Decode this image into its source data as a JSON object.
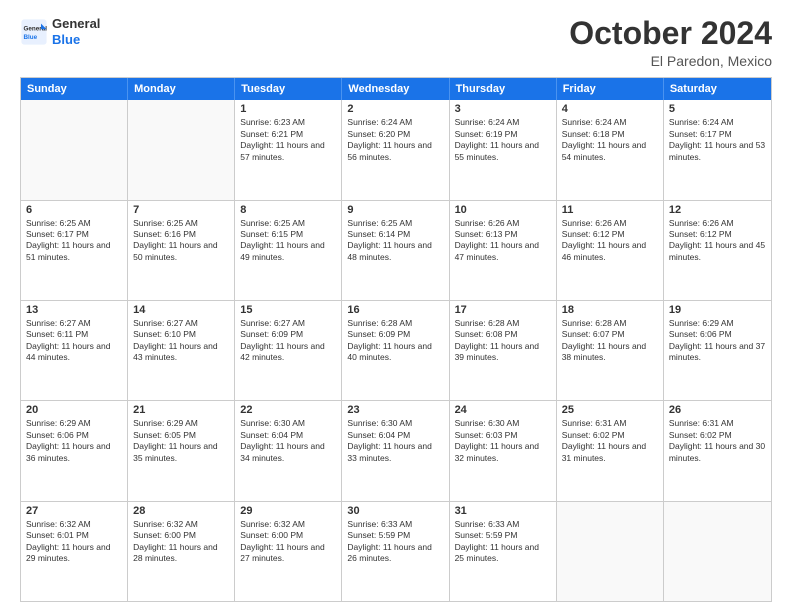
{
  "logo": {
    "line1": "General",
    "line2": "Blue"
  },
  "header": {
    "month": "October 2024",
    "location": "El Paredon, Mexico"
  },
  "weekdays": [
    "Sunday",
    "Monday",
    "Tuesday",
    "Wednesday",
    "Thursday",
    "Friday",
    "Saturday"
  ],
  "rows": [
    [
      {
        "day": "",
        "info": ""
      },
      {
        "day": "",
        "info": ""
      },
      {
        "day": "1",
        "info": "Sunrise: 6:23 AM\nSunset: 6:21 PM\nDaylight: 11 hours and 57 minutes."
      },
      {
        "day": "2",
        "info": "Sunrise: 6:24 AM\nSunset: 6:20 PM\nDaylight: 11 hours and 56 minutes."
      },
      {
        "day": "3",
        "info": "Sunrise: 6:24 AM\nSunset: 6:19 PM\nDaylight: 11 hours and 55 minutes."
      },
      {
        "day": "4",
        "info": "Sunrise: 6:24 AM\nSunset: 6:18 PM\nDaylight: 11 hours and 54 minutes."
      },
      {
        "day": "5",
        "info": "Sunrise: 6:24 AM\nSunset: 6:17 PM\nDaylight: 11 hours and 53 minutes."
      }
    ],
    [
      {
        "day": "6",
        "info": "Sunrise: 6:25 AM\nSunset: 6:17 PM\nDaylight: 11 hours and 51 minutes."
      },
      {
        "day": "7",
        "info": "Sunrise: 6:25 AM\nSunset: 6:16 PM\nDaylight: 11 hours and 50 minutes."
      },
      {
        "day": "8",
        "info": "Sunrise: 6:25 AM\nSunset: 6:15 PM\nDaylight: 11 hours and 49 minutes."
      },
      {
        "day": "9",
        "info": "Sunrise: 6:25 AM\nSunset: 6:14 PM\nDaylight: 11 hours and 48 minutes."
      },
      {
        "day": "10",
        "info": "Sunrise: 6:26 AM\nSunset: 6:13 PM\nDaylight: 11 hours and 47 minutes."
      },
      {
        "day": "11",
        "info": "Sunrise: 6:26 AM\nSunset: 6:12 PM\nDaylight: 11 hours and 46 minutes."
      },
      {
        "day": "12",
        "info": "Sunrise: 6:26 AM\nSunset: 6:12 PM\nDaylight: 11 hours and 45 minutes."
      }
    ],
    [
      {
        "day": "13",
        "info": "Sunrise: 6:27 AM\nSunset: 6:11 PM\nDaylight: 11 hours and 44 minutes."
      },
      {
        "day": "14",
        "info": "Sunrise: 6:27 AM\nSunset: 6:10 PM\nDaylight: 11 hours and 43 minutes."
      },
      {
        "day": "15",
        "info": "Sunrise: 6:27 AM\nSunset: 6:09 PM\nDaylight: 11 hours and 42 minutes."
      },
      {
        "day": "16",
        "info": "Sunrise: 6:28 AM\nSunset: 6:09 PM\nDaylight: 11 hours and 40 minutes."
      },
      {
        "day": "17",
        "info": "Sunrise: 6:28 AM\nSunset: 6:08 PM\nDaylight: 11 hours and 39 minutes."
      },
      {
        "day": "18",
        "info": "Sunrise: 6:28 AM\nSunset: 6:07 PM\nDaylight: 11 hours and 38 minutes."
      },
      {
        "day": "19",
        "info": "Sunrise: 6:29 AM\nSunset: 6:06 PM\nDaylight: 11 hours and 37 minutes."
      }
    ],
    [
      {
        "day": "20",
        "info": "Sunrise: 6:29 AM\nSunset: 6:06 PM\nDaylight: 11 hours and 36 minutes."
      },
      {
        "day": "21",
        "info": "Sunrise: 6:29 AM\nSunset: 6:05 PM\nDaylight: 11 hours and 35 minutes."
      },
      {
        "day": "22",
        "info": "Sunrise: 6:30 AM\nSunset: 6:04 PM\nDaylight: 11 hours and 34 minutes."
      },
      {
        "day": "23",
        "info": "Sunrise: 6:30 AM\nSunset: 6:04 PM\nDaylight: 11 hours and 33 minutes."
      },
      {
        "day": "24",
        "info": "Sunrise: 6:30 AM\nSunset: 6:03 PM\nDaylight: 11 hours and 32 minutes."
      },
      {
        "day": "25",
        "info": "Sunrise: 6:31 AM\nSunset: 6:02 PM\nDaylight: 11 hours and 31 minutes."
      },
      {
        "day": "26",
        "info": "Sunrise: 6:31 AM\nSunset: 6:02 PM\nDaylight: 11 hours and 30 minutes."
      }
    ],
    [
      {
        "day": "27",
        "info": "Sunrise: 6:32 AM\nSunset: 6:01 PM\nDaylight: 11 hours and 29 minutes."
      },
      {
        "day": "28",
        "info": "Sunrise: 6:32 AM\nSunset: 6:00 PM\nDaylight: 11 hours and 28 minutes."
      },
      {
        "day": "29",
        "info": "Sunrise: 6:32 AM\nSunset: 6:00 PM\nDaylight: 11 hours and 27 minutes."
      },
      {
        "day": "30",
        "info": "Sunrise: 6:33 AM\nSunset: 5:59 PM\nDaylight: 11 hours and 26 minutes."
      },
      {
        "day": "31",
        "info": "Sunrise: 6:33 AM\nSunset: 5:59 PM\nDaylight: 11 hours and 25 minutes."
      },
      {
        "day": "",
        "info": ""
      },
      {
        "day": "",
        "info": ""
      }
    ]
  ]
}
